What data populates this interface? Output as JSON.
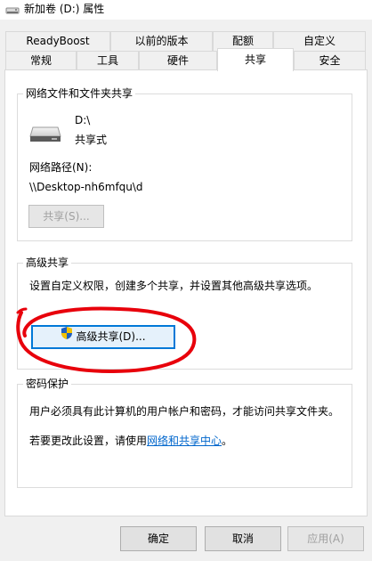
{
  "window": {
    "title": "新加卷 (D:) 属性"
  },
  "tabs_row_top": [
    "ReadyBoost",
    "以前的版本",
    "配额",
    "自定义"
  ],
  "tabs_row_bottom": [
    "常规",
    "工具",
    "硬件",
    "共享",
    "安全"
  ],
  "active_tab": "共享",
  "network_sharing": {
    "group_title": "网络文件和文件夹共享",
    "drive_letter": "D:\\",
    "status": "共享式",
    "path_label": "网络路径(N):",
    "path_value": "\\\\Desktop-nh6mfqu\\d",
    "share_button": "共享(S)..."
  },
  "advanced_sharing": {
    "group_title": "高级共享",
    "description": "设置自定义权限，创建多个共享，并设置其他高级共享选项。",
    "button": "高级共享(D)...",
    "annotation_color": "#e8000b"
  },
  "password_protection": {
    "group_title": "密码保护",
    "description": "用户必须具有此计算机的用户帐户和密码，才能访问共享文件夹。",
    "change_prefix": "若要更改此设置，请使用",
    "link_text": "网络和共享中心",
    "change_suffix": "。"
  },
  "footer": {
    "ok": "确定",
    "cancel": "取消",
    "apply": "应用(A)"
  },
  "colors": {
    "accent": "#0078d7",
    "link": "#0066cc",
    "shield_blue": "#1f5fbf",
    "shield_yellow": "#f2c200"
  }
}
